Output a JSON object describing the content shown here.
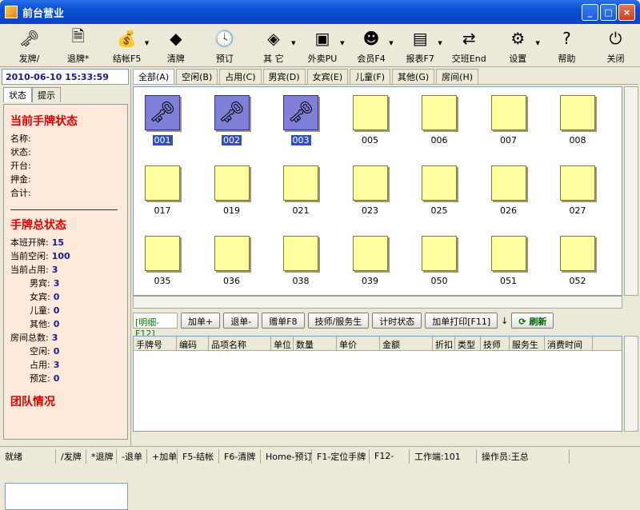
{
  "window": {
    "title": "前台营业",
    "minimize": "_",
    "maximize": "□",
    "close": "×"
  },
  "toolbar": [
    {
      "label": "发牌/",
      "icon": "key-card-icon",
      "glyph": "🗝",
      "arrow": false
    },
    {
      "label": "退牌*",
      "icon": "return-card-icon",
      "glyph": "🗎",
      "arrow": false
    },
    {
      "label": "结帐F5",
      "icon": "money-bag-icon",
      "glyph": "💰",
      "arrow": true
    },
    {
      "label": "清牌",
      "icon": "eraser-icon",
      "glyph": "◆",
      "arrow": false
    },
    {
      "label": "预订",
      "icon": "clock-icon",
      "glyph": "🕓",
      "arrow": false
    },
    {
      "label": "其 它",
      "icon": "other-icon",
      "glyph": "◈",
      "arrow": true
    },
    {
      "label": "外卖PU",
      "icon": "takeout-icon",
      "glyph": "▣",
      "arrow": true
    },
    {
      "label": "会员F4",
      "icon": "member-icon",
      "glyph": "☻",
      "arrow": true
    },
    {
      "label": "报表F7",
      "icon": "report-icon",
      "glyph": "▤",
      "arrow": true
    },
    {
      "label": "交班End",
      "icon": "shift-icon",
      "glyph": "⇄",
      "arrow": false
    },
    {
      "label": "设置",
      "icon": "settings-icon",
      "glyph": "⚙",
      "arrow": true
    },
    {
      "label": "帮助",
      "icon": "help-icon",
      "glyph": "?",
      "arrow": false
    },
    {
      "label": "关闭",
      "icon": "power-icon",
      "glyph": "⏻",
      "arrow": false
    }
  ],
  "left": {
    "datetime": "2010-06-10 15:33:59",
    "tabs": [
      "状态",
      "提示"
    ],
    "current_title": "当前手牌状态",
    "current_fields": [
      "名称:",
      "状态:",
      "开台:",
      "押金:",
      "合计:"
    ],
    "total_title": "手牌总状态",
    "totals": [
      {
        "label": "本班开牌:",
        "value": "15",
        "indent": false
      },
      {
        "label": "当前空闲:",
        "value": "100",
        "indent": false
      },
      {
        "label": "当前占用:",
        "value": "3",
        "indent": false
      },
      {
        "label": "男宾:",
        "value": "3",
        "indent": true
      },
      {
        "label": "女宾:",
        "value": "0",
        "indent": true
      },
      {
        "label": "儿童:",
        "value": "0",
        "indent": true
      },
      {
        "label": "其他:",
        "value": "0",
        "indent": true
      },
      {
        "label": "房间总数:",
        "value": "3",
        "indent": false
      },
      {
        "label": "空闲:",
        "value": "0",
        "indent": true
      },
      {
        "label": "占用:",
        "value": "3",
        "indent": true
      },
      {
        "label": "预定:",
        "value": "0",
        "indent": true
      }
    ],
    "team_title": "团队情况"
  },
  "filters": [
    "全部(A)",
    "空闲(B)",
    "占用(C)",
    "男宾(D)",
    "女宾(E)",
    "儿童(F)",
    "其他(G)",
    "房间(H)"
  ],
  "rooms": [
    {
      "num": "001",
      "occupied": true
    },
    {
      "num": "002",
      "occupied": true
    },
    {
      "num": "003",
      "occupied": true
    },
    {
      "num": "005",
      "occupied": false
    },
    {
      "num": "006",
      "occupied": false
    },
    {
      "num": "007",
      "occupied": false
    },
    {
      "num": "008",
      "occupied": false
    },
    {
      "num": "017",
      "occupied": false
    },
    {
      "num": "019",
      "occupied": false
    },
    {
      "num": "021",
      "occupied": false
    },
    {
      "num": "023",
      "occupied": false
    },
    {
      "num": "025",
      "occupied": false
    },
    {
      "num": "026",
      "occupied": false
    },
    {
      "num": "027",
      "occupied": false
    },
    {
      "num": "035",
      "occupied": false
    },
    {
      "num": "036",
      "occupied": false
    },
    {
      "num": "038",
      "occupied": false
    },
    {
      "num": "039",
      "occupied": false
    },
    {
      "num": "050",
      "occupied": false
    },
    {
      "num": "051",
      "occupied": false
    },
    {
      "num": "052",
      "occupied": false
    }
  ],
  "actions": {
    "detail": "[明细-F12]",
    "buttons": [
      "加单+",
      "退单-",
      "赠单F8",
      "技师/服务生",
      "计时状态",
      "加单打印[F11]"
    ],
    "arrow": "↓",
    "refresh": "刷新"
  },
  "table": {
    "columns": [
      "手牌号",
      "编码",
      "品项名称",
      "单位",
      "数量",
      "单价",
      "金额",
      "折扣",
      "类型",
      "技师",
      "服务生",
      "消费时间"
    ]
  },
  "statusbar": [
    "就绪",
    "/发牌",
    "*退牌",
    "-退单",
    "+加单",
    "F5-结帐",
    "F6-清牌",
    "Home-预订",
    "F1-定位手牌",
    "F12-",
    "工作端:101",
    "操作员:王总"
  ]
}
